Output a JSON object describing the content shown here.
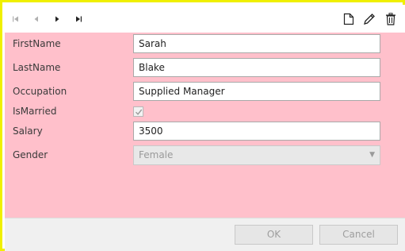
{
  "toolbar": {
    "nav_icons": [
      "first-record-icon",
      "previous-record-icon",
      "next-record-icon",
      "last-record-icon"
    ],
    "tool_icons": [
      "new-document-icon",
      "edit-pencil-icon",
      "delete-trash-icon"
    ]
  },
  "form": {
    "firstname_label": "FirstName",
    "firstname_value": "Sarah",
    "lastname_label": "LastName",
    "lastname_value": "Blake",
    "occupation_label": "Occupation",
    "occupation_value": "Supplied Manager",
    "ismarried_label": "IsMarried",
    "ismarried_checked": true,
    "salary_label": "Salary",
    "salary_value": "3500",
    "gender_label": "Gender",
    "gender_value": "Female"
  },
  "footer": {
    "ok_label": "OK",
    "cancel_label": "Cancel"
  },
  "colors": {
    "frame_border": "#f0f000",
    "form_background": "#ffc0cb",
    "footer_background": "#f0f0f0"
  }
}
